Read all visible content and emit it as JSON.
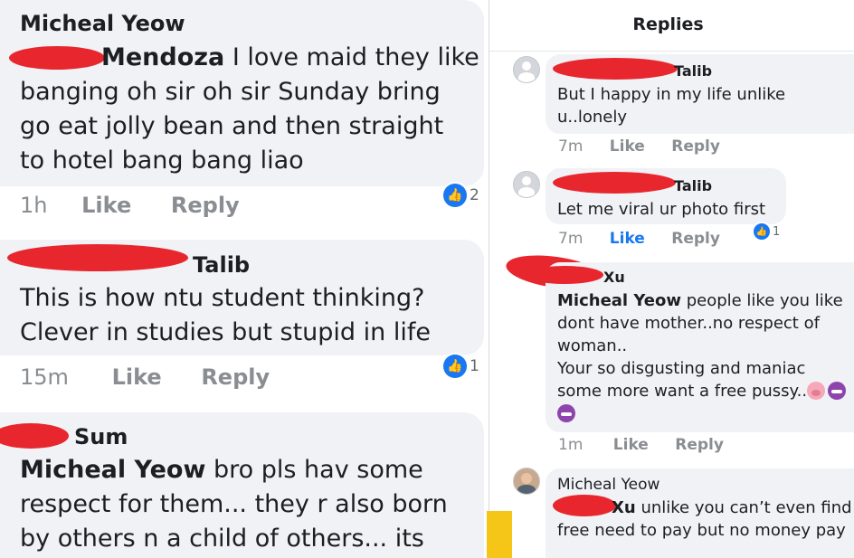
{
  "left": {
    "comments": [
      {
        "author": "Micheal Yeow",
        "tag_suffix": "Mendoza",
        "lines": [
          "I love maid they like",
          "banging oh sir oh sir Sunday bring",
          "go eat jolly bean and then straight",
          "to hotel bang bang liao"
        ],
        "time": "1h",
        "like": "Like",
        "reply": "Reply",
        "reactions": "2"
      },
      {
        "author_suffix": "Talib",
        "lines": [
          "This is how ntu student thinking?",
          "Clever in studies but stupid in life"
        ],
        "time": "15m",
        "like": "Like",
        "reply": "Reply",
        "reactions": "1"
      },
      {
        "author_suffix": "Sum",
        "mention": "Micheal Yeow",
        "lines": [
          "bro pls hav some",
          "respect for them... they r also born",
          "by others n a child of others... its"
        ]
      }
    ]
  },
  "right": {
    "title": "Replies",
    "replies": [
      {
        "author_suffix": "Talib",
        "lines": [
          "But I happy in my life unlike",
          "u..lonely"
        ],
        "time": "7m",
        "like": "Like",
        "reply": "Reply"
      },
      {
        "author_suffix": "Talib",
        "lines": [
          "Let me viral ur photo first"
        ],
        "time": "7m",
        "like": "Like",
        "reply": "Reply",
        "reactions": "1"
      },
      {
        "author_suffix": "Xu",
        "mention": "Micheal Yeow",
        "lines": [
          "people like you like",
          "dont have mother..no respect  of",
          "woman..",
          "Your so disgusting  and maniac",
          "some more want a free pussy.."
        ],
        "emojis": [
          "pig-emoji",
          "devil-emoji",
          "devil-emoji"
        ],
        "time": "1m",
        "like": "Like",
        "reply": "Reply"
      },
      {
        "author": "Micheal Yeow",
        "tag_suffix": "Xu",
        "lines": [
          "unlike you can’t even find",
          "free need to pay but no money pay"
        ]
      }
    ]
  },
  "colors": {
    "accent": "#1877f2",
    "bubble": "#f0f2f5",
    "meta": "#8a8d91",
    "redaction": "#e8262e"
  }
}
